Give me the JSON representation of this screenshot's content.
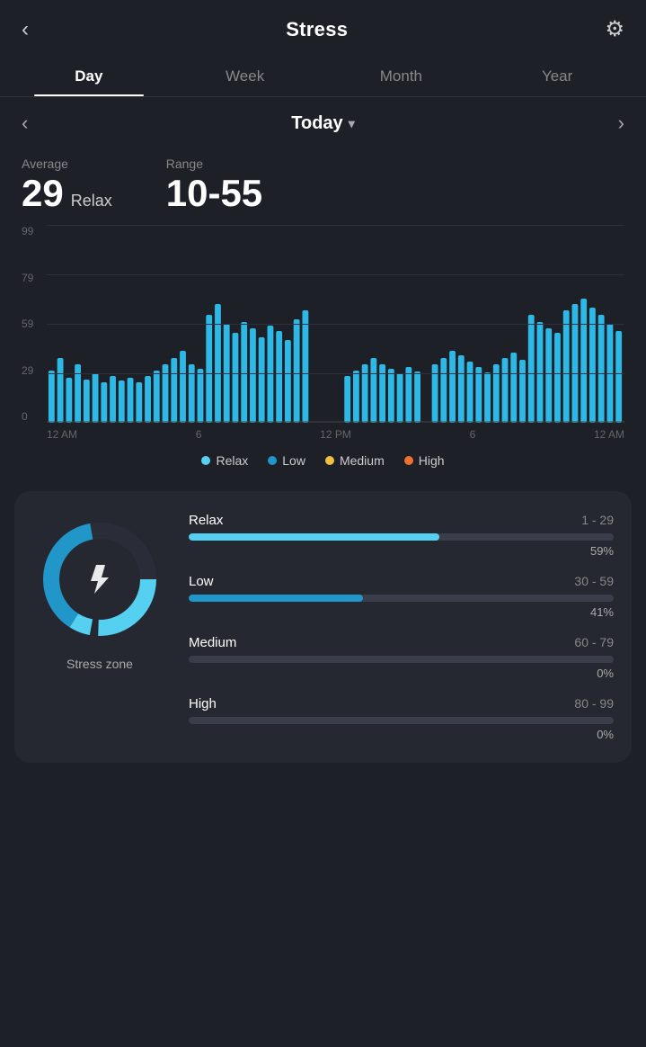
{
  "header": {
    "back_label": "‹",
    "title": "Stress",
    "settings_icon": "⚙"
  },
  "tabs": [
    {
      "id": "day",
      "label": "Day",
      "active": true
    },
    {
      "id": "week",
      "label": "Week",
      "active": false
    },
    {
      "id": "month",
      "label": "Month",
      "active": false
    },
    {
      "id": "year",
      "label": "Year",
      "active": false
    }
  ],
  "nav": {
    "prev_icon": "‹",
    "next_icon": "›",
    "title": "Today",
    "dropdown_icon": "▾"
  },
  "stats": {
    "average_label": "Average",
    "average_value": "29",
    "average_unit": "Relax",
    "range_label": "Range",
    "range_value": "10-55"
  },
  "chart": {
    "y_labels": [
      "99",
      "79",
      "59",
      "29",
      "0"
    ],
    "x_labels": [
      "12 AM",
      "6",
      "12 PM",
      "6",
      "12 AM"
    ],
    "accent_color": "#2eb8e6"
  },
  "legend": [
    {
      "id": "relax",
      "label": "Relax",
      "color": "#56d0f0"
    },
    {
      "id": "low",
      "label": "Low",
      "color": "#2196c8"
    },
    {
      "id": "medium",
      "label": "Medium",
      "color": "#f0c040"
    },
    {
      "id": "high",
      "label": "High",
      "color": "#f07030"
    }
  ],
  "stress_zone": {
    "card_title": "Stress zone",
    "zones": [
      {
        "name": "Relax",
        "range": "1 - 29",
        "pct": 59,
        "color": "#56d0f0"
      },
      {
        "name": "Low",
        "range": "30 - 59",
        "pct": 41,
        "color": "#2196c8"
      },
      {
        "name": "Medium",
        "range": "60 - 79",
        "pct": 0,
        "color": "#888"
      },
      {
        "name": "High",
        "range": "80 - 99",
        "pct": 0,
        "color": "#888"
      }
    ]
  }
}
